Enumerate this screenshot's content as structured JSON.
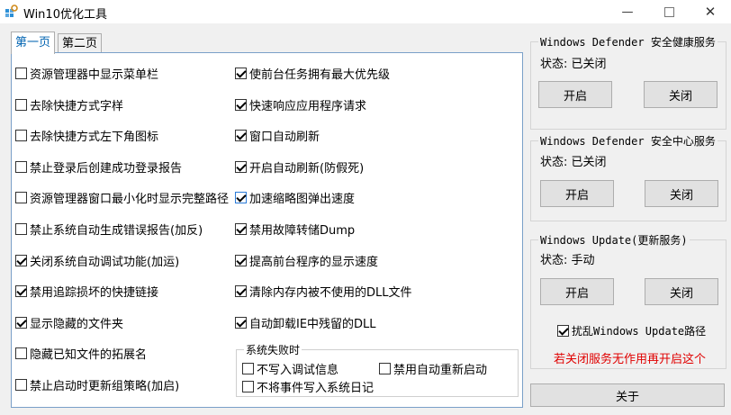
{
  "window": {
    "title": "Win10优化工具",
    "controls": {
      "minimize": "—",
      "close": "✕"
    }
  },
  "tabs": [
    {
      "label": "第一页",
      "selected": true
    },
    {
      "label": "第二页",
      "selected": false
    }
  ],
  "left_column": [
    {
      "label": "资源管理器中显示菜单栏",
      "checked": false
    },
    {
      "label": "去除快捷方式字样",
      "checked": false
    },
    {
      "label": "去除快捷方式左下角图标",
      "checked": false
    },
    {
      "label": "禁止登录后创建成功登录报告",
      "checked": false
    },
    {
      "label": "资源管理器窗口最小化时显示完整路径",
      "checked": false
    },
    {
      "label": "禁止系统自动生成错误报告(加反)",
      "checked": false
    },
    {
      "label": "关闭系统自动调试功能(加运)",
      "checked": true
    },
    {
      "label": "禁用追踪损坏的快捷链接",
      "checked": true
    },
    {
      "label": "显示隐藏的文件夹",
      "checked": true
    },
    {
      "label": "隐藏已知文件的拓展名",
      "checked": false
    },
    {
      "label": "禁止启动时更新组策略(加启)",
      "checked": false
    }
  ],
  "right_column": [
    {
      "label": "使前台任务拥有最大优先级",
      "checked": true
    },
    {
      "label": "快速响应应用程序请求",
      "checked": true
    },
    {
      "label": "窗口自动刷新",
      "checked": true
    },
    {
      "label": "开启自动刷新(防假死)",
      "checked": true
    },
    {
      "label": "加速缩略图弹出速度",
      "checked": true
    },
    {
      "label": "禁用故障转储Dump",
      "checked": true
    },
    {
      "label": "提高前台程序的显示速度",
      "checked": true
    },
    {
      "label": "清除内存内被不使用的DLL文件",
      "checked": true
    },
    {
      "label": "自动卸载IE中残留的DLL",
      "checked": true
    }
  ],
  "system_failure": {
    "title": "系统失败时",
    "options": [
      {
        "label": "不写入调试信息",
        "checked": false
      },
      {
        "label": "禁用自动重新启动",
        "checked": false
      },
      {
        "label": "不将事件写入系统日记",
        "checked": false
      }
    ]
  },
  "services": [
    {
      "title": "Windows Defender 安全健康服务",
      "status": "状态: 已关闭",
      "on_label": "开启",
      "off_label": "关闭"
    },
    {
      "title": "Windows Defender 安全中心服务",
      "status": "状态: 已关闭",
      "on_label": "开启",
      "off_label": "关闭"
    },
    {
      "title": "Windows Update(更新服务)",
      "status": "状态: 手动",
      "on_label": "开启",
      "off_label": "关闭"
    }
  ],
  "update_path": {
    "label": "扰乱Windows Update路径",
    "checked": true
  },
  "warning": "若关闭服务无作用再开启这个",
  "about_label": "关于",
  "colors": {
    "warning": "#e00000",
    "selected_tab": "#0063b1",
    "panel_border": "#7aa0c8"
  },
  "icons": {
    "app": "gear-grid-icon"
  }
}
